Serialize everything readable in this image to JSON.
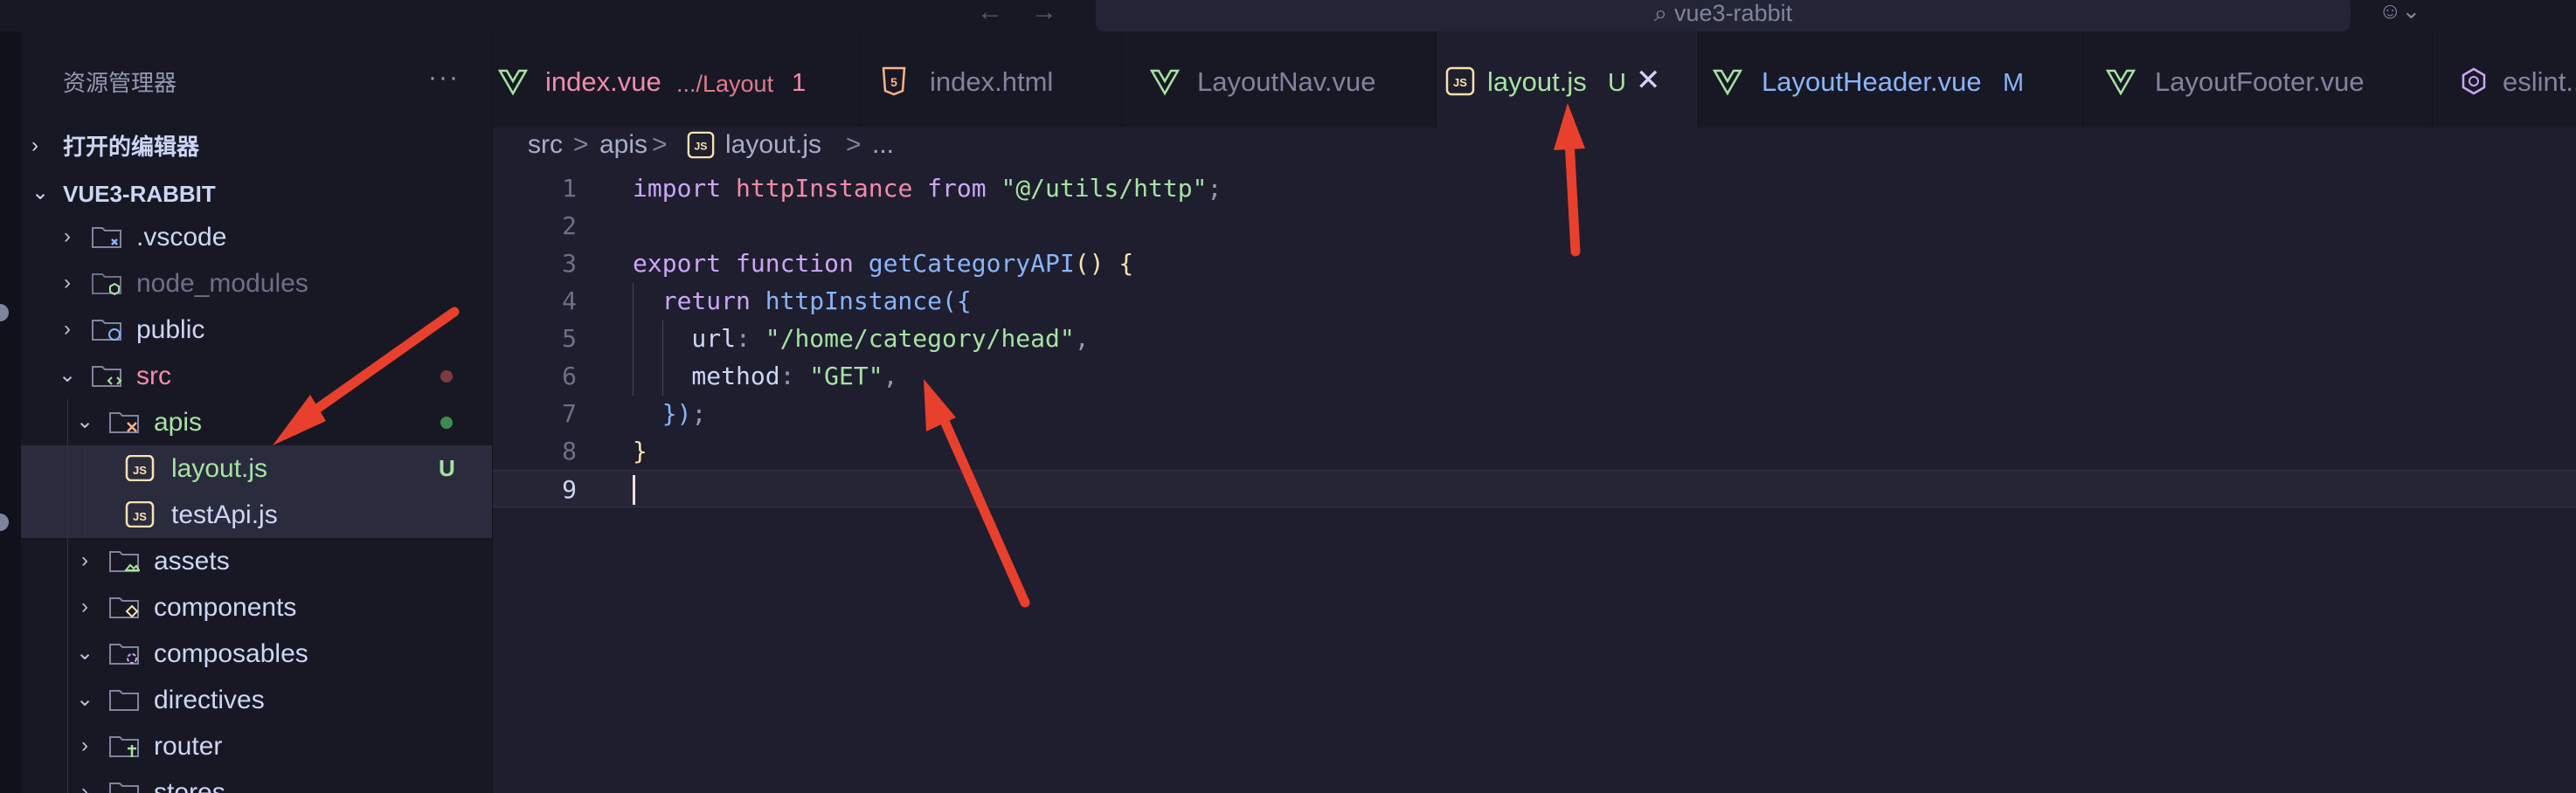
{
  "titlebar": {
    "back_glyph": "←",
    "forward_glyph": "→",
    "search_text": "vue3-rabbit",
    "search_glyph": "⌕",
    "copilot_glyph": "☺⌄"
  },
  "sidebar": {
    "title": "资源管理器",
    "more_glyph": "···",
    "open_editors_label": "打开的编辑器",
    "project_label": "VUE3-RABBIT",
    "items": [
      {
        "name": ".vscode",
        "color": "#cdd6f4"
      },
      {
        "name": "node_modules",
        "color": "#6c7086"
      },
      {
        "name": "public",
        "color": "#cdd6f4"
      },
      {
        "name": "src",
        "color": "#f38ba8"
      },
      {
        "name": "apis",
        "color": "#a6e3a1"
      },
      {
        "name": "layout.js",
        "color": "#a6e3a1",
        "badge": "U"
      },
      {
        "name": "testApi.js",
        "color": "#cdd6f4"
      },
      {
        "name": "assets",
        "color": "#cdd6f4"
      },
      {
        "name": "components",
        "color": "#cdd6f4"
      },
      {
        "name": "composables",
        "color": "#cdd6f4"
      },
      {
        "name": "directives",
        "color": "#cdd6f4"
      },
      {
        "name": "router",
        "color": "#cdd6f4"
      },
      {
        "name": "stores",
        "color": "#cdd6f4"
      }
    ]
  },
  "tabs": [
    {
      "label": "index.vue",
      "desc": ".../Layout",
      "badge": "1",
      "color": "#f38ba8",
      "icon": "vue-icon"
    },
    {
      "label": "index.html",
      "color": "#7f849c",
      "icon": "html5-icon"
    },
    {
      "label": "LayoutNav.vue",
      "color": "#7f849c",
      "icon": "vue-icon"
    },
    {
      "label": "layout.js",
      "badge": "U",
      "color": "#a6e3a1",
      "icon": "js-icon",
      "close": "✕"
    },
    {
      "label": "LayoutHeader.vue",
      "badge": "M",
      "color": "#89b4fa",
      "icon": "vue-icon"
    },
    {
      "label": "LayoutFooter.vue",
      "color": "#7f849c",
      "icon": "vue-icon"
    },
    {
      "label": "eslint...",
      "color": "#7f849c",
      "icon": "eslint-icon"
    }
  ],
  "breadcrumb": {
    "parts": [
      "src",
      "apis",
      "layout.js",
      "..."
    ],
    "sep": ">"
  },
  "editor": {
    "line_numbers": [
      "1",
      "2",
      "3",
      "4",
      "5",
      "6",
      "7",
      "8",
      "9"
    ],
    "lines": [
      [
        {
          "t": "import ",
          "c": "kw"
        },
        {
          "t": "httpInstance",
          "c": "var"
        },
        {
          "t": " from ",
          "c": "kw"
        },
        {
          "t": "\"@/utils/http\"",
          "c": "str"
        },
        {
          "t": ";",
          "c": "pun"
        }
      ],
      [],
      [
        {
          "t": "export ",
          "c": "kw"
        },
        {
          "t": "function ",
          "c": "kw"
        },
        {
          "t": "getCategoryAPI",
          "c": "fn"
        },
        {
          "t": "() {",
          "c": "br"
        }
      ],
      [
        {
          "t": "  return ",
          "c": "kw"
        },
        {
          "t": "httpInstance",
          "c": "fn"
        },
        {
          "t": "({",
          "c": "br2"
        }
      ],
      [
        {
          "t": "    url",
          "c": "prop"
        },
        {
          "t": ": ",
          "c": "pun"
        },
        {
          "t": "\"/home/category/head\"",
          "c": "str"
        },
        {
          "t": ",",
          "c": "pun"
        }
      ],
      [
        {
          "t": "    method",
          "c": "prop"
        },
        {
          "t": ": ",
          "c": "pun"
        },
        {
          "t": "\"GET\"",
          "c": "str"
        },
        {
          "t": ",",
          "c": "pun"
        }
      ],
      [
        {
          "t": "  })",
          "c": "br2"
        },
        {
          "t": ";",
          "c": "pun"
        }
      ],
      [
        {
          "t": "}",
          "c": "br"
        }
      ],
      []
    ]
  },
  "colors": {
    "background": "#1e1e2e",
    "sidebar": "#181825",
    "annotation_arrow": "#e8402c"
  }
}
